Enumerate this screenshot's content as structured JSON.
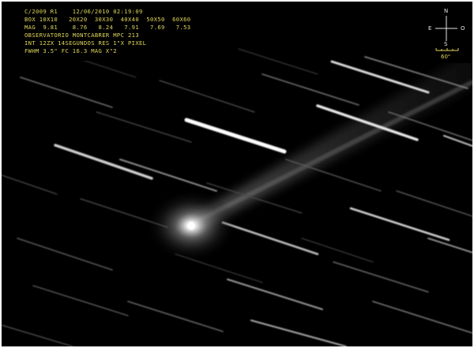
{
  "overlay": {
    "lines": [
      "C/2009 R1    12/06/2010 02:19:09",
      "BOX 10X10   20X20  30X30  40X40  50X50  60X60",
      "MAG  9.81    8.76   8.24   7.91   7.69   7.53",
      "OBSERVATORIO MONTCABRER MPC 213",
      "INT 12ZX 14SEGUNDOS RES 1\"X PIXEL",
      "FWHM 3.5\" FC 16.3 MAG X\"2"
    ],
    "text_color": "#e0d65a"
  },
  "compass": {
    "north": "N",
    "south": "S",
    "east": "E",
    "west": "O",
    "scale": "60\""
  },
  "colors": {
    "sky": "#000000",
    "border": "#ffffff",
    "coma": "#f4f4f4"
  }
}
